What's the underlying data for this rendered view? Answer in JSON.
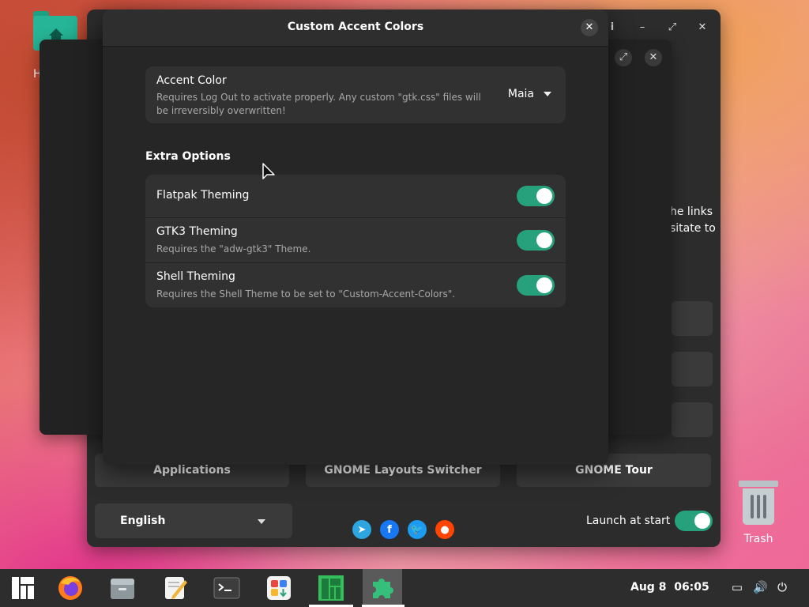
{
  "desktop": {
    "home_label": "H",
    "trash_label": "Trash"
  },
  "welcome_window": {
    "links_text_line1": "he links",
    "links_text_line2": "sitate to",
    "buttons": [
      {
        "label": "Applications"
      },
      {
        "label": "GNOME Layouts Switcher"
      },
      {
        "label": "GNOME Tour"
      }
    ],
    "language": "English",
    "launch_at_start_label": "Launch at start",
    "launch_at_start": true,
    "social_icons": [
      "telegram-icon",
      "facebook-icon",
      "twitter-icon",
      "reddit-icon"
    ]
  },
  "dialog": {
    "title": "Custom Accent Colors",
    "close_glyph": "✕",
    "accent": {
      "title": "Accent Color",
      "subtitle": "Requires Log Out to activate properly. Any custom \"gtk.css\" files will be irreversibly overwritten!",
      "value": "Maia"
    },
    "extra_options_title": "Extra Options",
    "options": [
      {
        "title": "Flatpak Theming",
        "subtitle": "",
        "enabled": true
      },
      {
        "title": "GTK3 Theming",
        "subtitle": "Requires the \"adw-gtk3\" Theme.",
        "enabled": true
      },
      {
        "title": "Shell Theming",
        "subtitle": "Requires the Shell Theme to be set to \"Custom-Accent-Colors\".",
        "enabled": true
      }
    ]
  },
  "colors": {
    "accent": "#26a17b",
    "dialog_bg": "#262626",
    "card_bg": "#313131"
  },
  "taskbar": {
    "clock_date": "Aug 8",
    "clock_time": "06:05"
  }
}
